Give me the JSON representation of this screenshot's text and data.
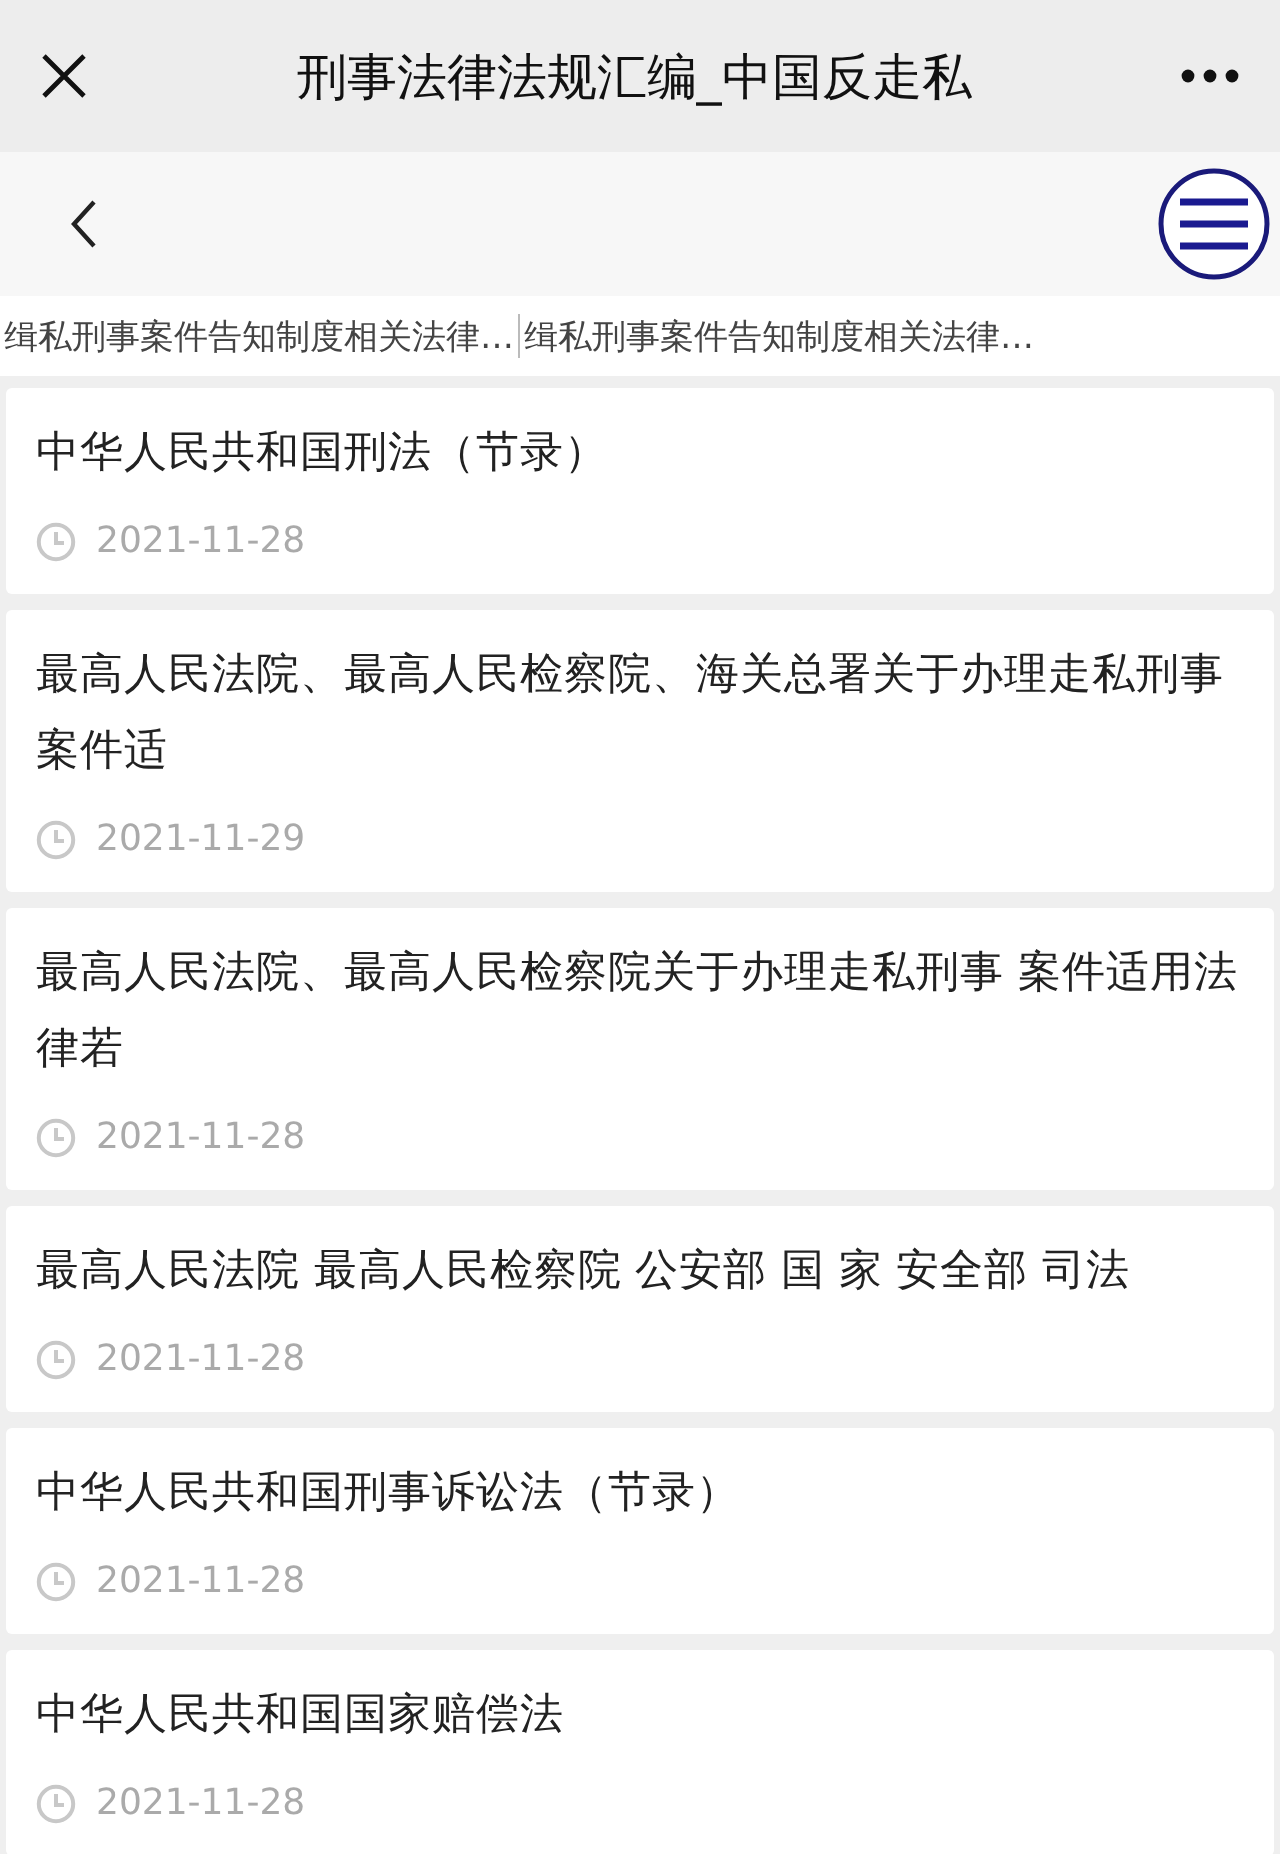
{
  "window": {
    "title": "刑事法律法规汇编_中国反走私"
  },
  "tabs": [
    {
      "label": "缉私刑事案件告知制度相关法律…"
    },
    {
      "label": "缉私刑事案件告知制度相关法律…"
    }
  ],
  "articles": [
    {
      "title": "中华人民共和国刑法（节录）",
      "date": "2021-11-28"
    },
    {
      "title": "最高人民法院、最高人民检察院、海关总署关于办理走私刑事案件适",
      "date": "2021-11-29"
    },
    {
      "title": "最高人民法院、最高人民检察院关于办理走私刑事 案件适用法律若",
      "date": "2021-11-28"
    },
    {
      "title": "最高人民法院 最高人民检察院 公安部 国 家 安全部 司法",
      "date": "2021-11-28"
    },
    {
      "title": "中华人民共和国刑事诉讼法（节录）",
      "date": "2021-11-28"
    },
    {
      "title": "中华人民共和国国家赔偿法",
      "date": "2021-11-28"
    }
  ]
}
